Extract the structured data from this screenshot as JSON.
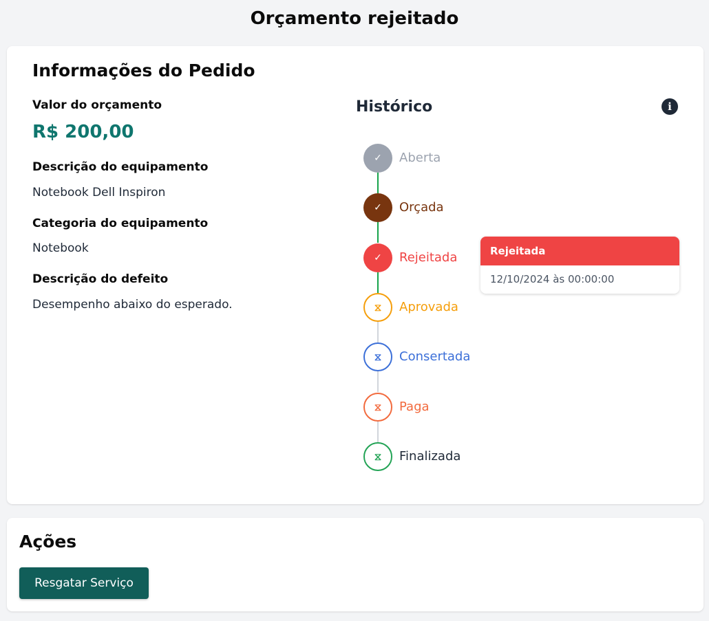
{
  "page": {
    "title": "Orçamento rejeitado"
  },
  "info": {
    "title": "Informações do Pedido",
    "fields": [
      {
        "label": "Valor do orçamento",
        "value": "R$ 200,00"
      },
      {
        "label": "Descrição do equipamento",
        "value": "Notebook Dell Inspiron"
      },
      {
        "label": "Categoria do equipamento",
        "value": "Notebook"
      },
      {
        "label": "Descrição do defeito",
        "value": "Desempenho abaixo do esperado."
      }
    ]
  },
  "history": {
    "title": "Histórico",
    "info_icon": "info-icon",
    "steps": [
      {
        "label": "Aberta",
        "status": "done",
        "icon": "check-icon",
        "color": "#9ca3af"
      },
      {
        "label": "Orçada",
        "status": "done",
        "icon": "check-icon",
        "color": "#78350f"
      },
      {
        "label": "Rejeitada",
        "status": "done",
        "icon": "check-icon",
        "color": "#ef4444"
      },
      {
        "label": "Aprovada",
        "status": "pending",
        "icon": "hourglass-icon",
        "color": "#f59e0b"
      },
      {
        "label": "Consertada",
        "status": "pending",
        "icon": "hourglass-icon",
        "color": "#3b6fd8"
      },
      {
        "label": "Paga",
        "status": "pending",
        "icon": "hourglass-icon",
        "color": "#f26a3d"
      },
      {
        "label": "Finalizada",
        "status": "pending",
        "icon": "hourglass-icon",
        "color": "#22a355"
      }
    ],
    "connector_colors": {
      "done": "#16a34a",
      "pending": "#d1d5db"
    },
    "tooltip": {
      "title": "Rejeitada",
      "date": "12/10/2024 às 00:00:00",
      "color": "#ef4444"
    }
  },
  "actions": {
    "title": "Ações",
    "button_label": "Resgatar Serviço",
    "button_color": "#115e59"
  },
  "colors": {
    "accent": "#0f766e"
  }
}
